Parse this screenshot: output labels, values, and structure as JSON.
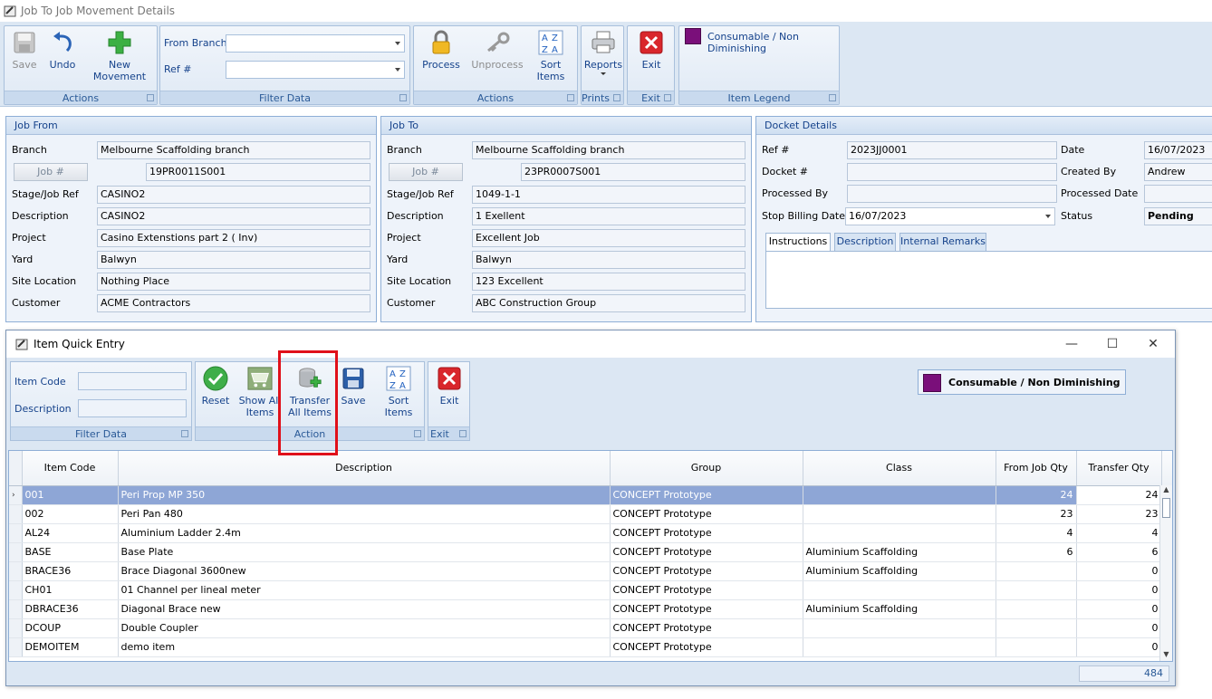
{
  "window": {
    "title": "Job To Job Movement Details"
  },
  "ribbon": {
    "actions1": {
      "caption": "Actions",
      "save": "Save",
      "undo": "Undo",
      "new_movement": "New Movement"
    },
    "filter": {
      "caption": "Filter Data",
      "from_branch_label": "From Branch",
      "ref_label": "Ref #",
      "from_branch_value": "",
      "ref_value": ""
    },
    "actions2": {
      "caption": "Actions",
      "process": "Process",
      "unprocess": "Unprocess",
      "sort_items": "Sort Items"
    },
    "prints": {
      "caption": "Prints",
      "reports": "Reports"
    },
    "exit": {
      "caption": "Exit",
      "exit": "Exit"
    },
    "legend": {
      "caption": "Item Legend",
      "consumable": "Consumable / Non Diminishing",
      "color": "#7a0f7a"
    }
  },
  "job_from": {
    "title": "Job From",
    "branch_label": "Branch",
    "branch": "Melbourne Scaffolding branch",
    "job_btn": "Job #",
    "job": "19PR0011S001",
    "stage_label": "Stage/Job Ref",
    "stage": "CASINO2",
    "desc_label": "Description",
    "desc": "CASINO2",
    "project_label": "Project",
    "project": "Casino Extenstions part 2 ( Inv)",
    "yard_label": "Yard",
    "yard": "Balwyn",
    "site_label": "Site Location",
    "site": "Nothing Place",
    "customer_label": "Customer",
    "customer": "ACME Contractors"
  },
  "job_to": {
    "title": "Job To",
    "branch_label": "Branch",
    "branch": "Melbourne Scaffolding branch",
    "job_btn": "Job #",
    "job": "23PR0007S001",
    "stage_label": "Stage/Job Ref",
    "stage": "1049-1-1",
    "desc_label": "Description",
    "desc": "1 Exellent",
    "project_label": "Project",
    "project": "Excellent Job",
    "yard_label": "Yard",
    "yard": "Balwyn",
    "site_label": "Site Location",
    "site": "123 Excellent",
    "customer_label": "Customer",
    "customer": "ABC Construction Group"
  },
  "docket": {
    "title": "Docket Details",
    "ref_label": "Ref #",
    "ref": "2023JJ0001",
    "date_label": "Date",
    "date": "16/07/2023",
    "docket_label": "Docket #",
    "docket": "",
    "created_label": "Created By",
    "created": "Andrew",
    "processed_label": "Processed By",
    "processed": "",
    "pdate_label": "Processed Date",
    "pdate": "",
    "stop_label": "Stop Billing Date",
    "stop": "16/07/2023",
    "status_label": "Status",
    "status": "Pending",
    "tabs": [
      "Instructions",
      "Description",
      "Internal Remarks"
    ]
  },
  "quick": {
    "title": "Item Quick Entry",
    "item_code_label": "Item Code",
    "description_label": "Description",
    "filter_caption": "Filter Data",
    "action_caption": "Action",
    "exit_caption": "Exit",
    "reset": "Reset",
    "show_all_1": "Show All",
    "show_all_2": "Items",
    "transfer_1": "Transfer",
    "transfer_2": "All Items",
    "save": "Save",
    "sort": "Sort Items",
    "exit": "Exit",
    "legend": "Consumable / Non Diminishing",
    "columns": [
      "Item Code",
      "Description",
      "Group",
      "Class",
      "From Job Qty",
      "Transfer Qty"
    ],
    "rows": [
      {
        "code": "001",
        "desc": "Peri Prop MP 350",
        "group": "CONCEPT Prototype",
        "cls": "",
        "from": "24",
        "transfer": "24"
      },
      {
        "code": "002",
        "desc": "Peri Pan 480",
        "group": "CONCEPT Prototype",
        "cls": "",
        "from": "23",
        "transfer": "23"
      },
      {
        "code": "AL24",
        "desc": "Aluminium Ladder 2.4m",
        "group": "CONCEPT Prototype",
        "cls": "",
        "from": "4",
        "transfer": "4"
      },
      {
        "code": "BASE",
        "desc": "Base Plate",
        "group": "CONCEPT Prototype",
        "cls": "Aluminium Scaffolding",
        "from": "6",
        "transfer": "6"
      },
      {
        "code": "BRACE36",
        "desc": "Brace Diagonal 3600new",
        "group": "CONCEPT Prototype",
        "cls": "Aluminium Scaffolding",
        "from": "",
        "transfer": "0"
      },
      {
        "code": "CH01",
        "desc": "01 Channel per lineal meter",
        "group": "CONCEPT Prototype",
        "cls": "",
        "from": "",
        "transfer": "0"
      },
      {
        "code": "DBRACE36",
        "desc": "Diagonal Brace new",
        "group": "CONCEPT Prototype",
        "cls": "Aluminium Scaffolding",
        "from": "",
        "transfer": "0"
      },
      {
        "code": "DCOUP",
        "desc": "Double Coupler",
        "group": "CONCEPT Prototype",
        "cls": "",
        "from": "",
        "transfer": "0"
      },
      {
        "code": "DEMOITEM",
        "desc": "demo item",
        "group": "CONCEPT Prototype",
        "cls": "",
        "from": "",
        "transfer": "0"
      }
    ],
    "total": "484"
  }
}
